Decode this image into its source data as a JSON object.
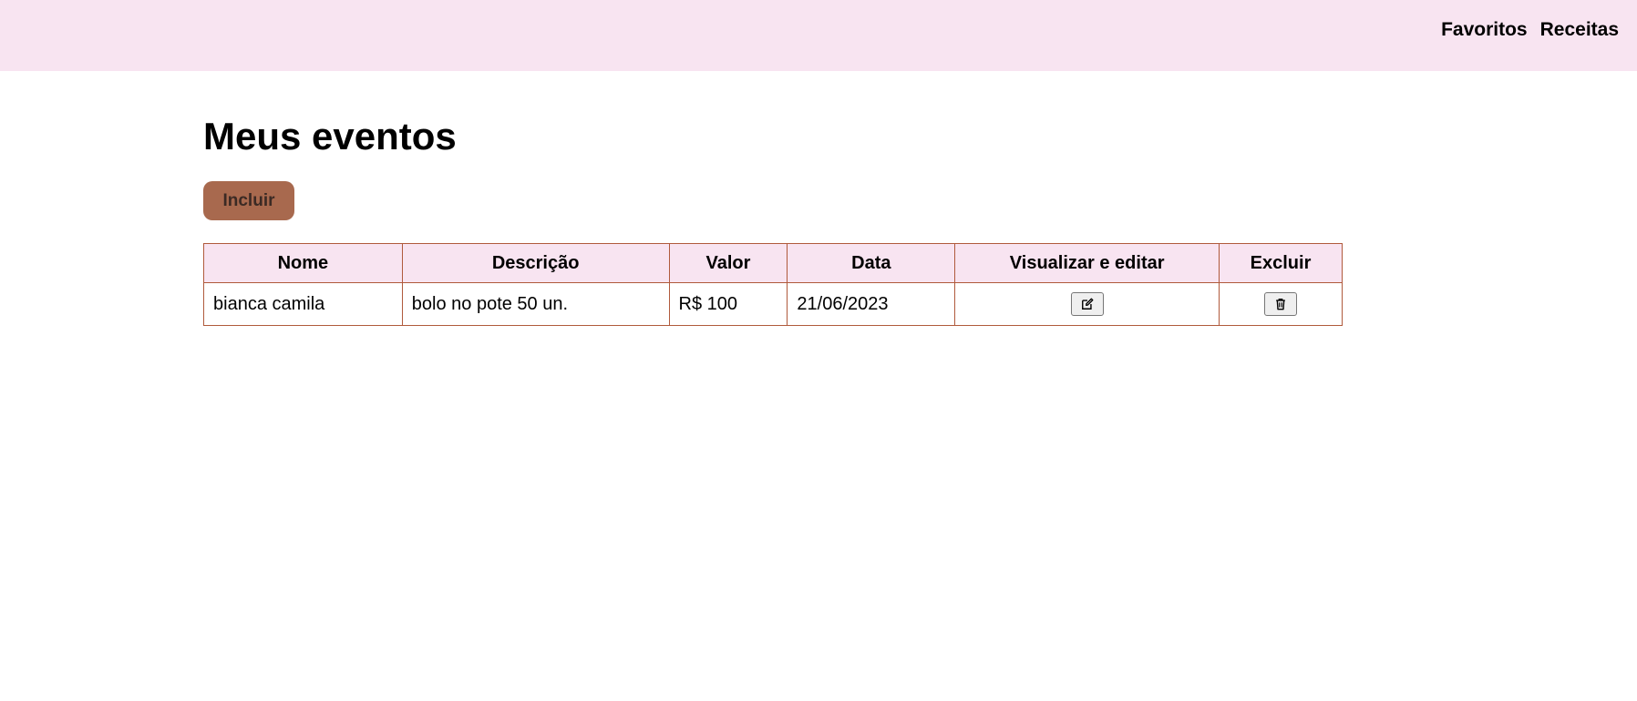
{
  "nav": {
    "favorites": "Favoritos",
    "recipes": "Receitas"
  },
  "page": {
    "title": "Meus eventos",
    "add_label": "Incluir"
  },
  "table": {
    "headers": [
      "Nome",
      "Descrição",
      "Valor",
      "Data",
      "Visualizar e editar",
      "Excluir"
    ],
    "rows": [
      {
        "name": "bianca camila",
        "description": "bolo no pote 50 un.",
        "value": "R$ 100",
        "date": "21/06/2023",
        "edit_icon": "edit-icon",
        "delete_icon": "trash-icon"
      }
    ]
  },
  "colors": {
    "topbar_bg": "#f8e4f1",
    "button_bg": "#a8694e",
    "table_border": "#b05a3c",
    "header_bg": "#f8e4f1"
  }
}
